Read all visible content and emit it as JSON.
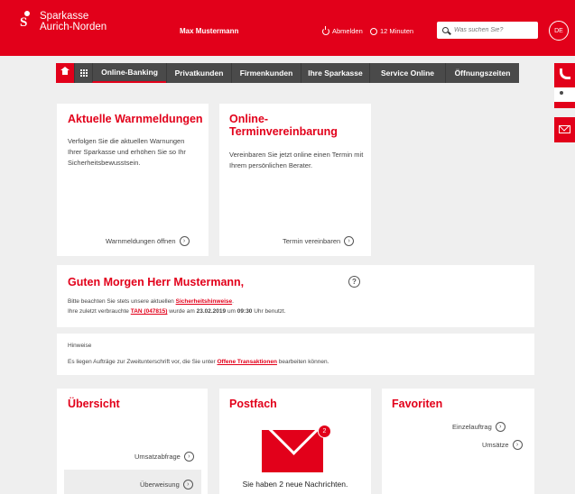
{
  "header": {
    "logo_line1": "Sparkasse",
    "logo_line2": "Aurich-Norden",
    "user_name": "Max Mustermann",
    "logout_label": "Abmelden",
    "timer_label": "12 Minuten",
    "search_placeholder": "Was suchen Sie?",
    "language": "DE",
    "brand_color": "#e2001a"
  },
  "nav": {
    "home_icon": "home-icon",
    "grid_icon": "grid-icon",
    "items": [
      {
        "label": "Online-Banking",
        "active": true
      },
      {
        "label": "Privatkunden"
      },
      {
        "label": "Firmenkunden"
      },
      {
        "label": "Ihre Sparkasse"
      },
      {
        "label": "Service Online"
      },
      {
        "label": "Öffnungszeiten"
      }
    ]
  },
  "warnings": {
    "title": "Aktuelle Warnmeldungen",
    "text": "Verfolgen Sie die aktuellen Warnungen Ihrer Sparkasse und erhöhen Sie so Ihr Sicherheitsbewusstsein.",
    "link": "Warnmeldungen öffnen"
  },
  "termin": {
    "title_line1": "Online-",
    "title_line2": "Terminvereinbarung",
    "text": "Vereinbaren Sie jetzt online einen Termin mit Ihrem persönlichen Berater.",
    "link": "Termin vereinbaren"
  },
  "greeting": {
    "title": "Guten Morgen Herr Mustermann,",
    "help": "?",
    "line1_pre": "Bitte beachten Sie stets unsere aktuellen ",
    "line1_link": "Sicherheitshinweise",
    "line1_post": ".",
    "line2_pre": "Ihre zuletzt verbrauchte ",
    "line2_tan": "TAN (047815)",
    "line2_mid": " wurde am ",
    "line2_date": "23.02.2019",
    "line2_mid2": " um ",
    "line2_time": "09:30",
    "line2_post": " Uhr benutzt."
  },
  "hints": {
    "heading": "Hinweise",
    "text_pre": "Es liegen Aufträge zur Zweitunterschrift vor, die Sie unter ",
    "text_link": "Offene Transaktionen",
    "text_post": " bearbeiten können."
  },
  "overview": {
    "title": "Übersicht",
    "links": [
      "Umsatzabfrage",
      "Überweisung"
    ]
  },
  "postfach": {
    "title": "Postfach",
    "badge": "2",
    "message": "Sie haben 2 neue Nachrichten."
  },
  "favorites": {
    "title": "Favoriten",
    "links": [
      "Einzelauftrag",
      "Umsätze"
    ]
  },
  "side_tabs": [
    "phone-icon",
    "mail-icon"
  ]
}
